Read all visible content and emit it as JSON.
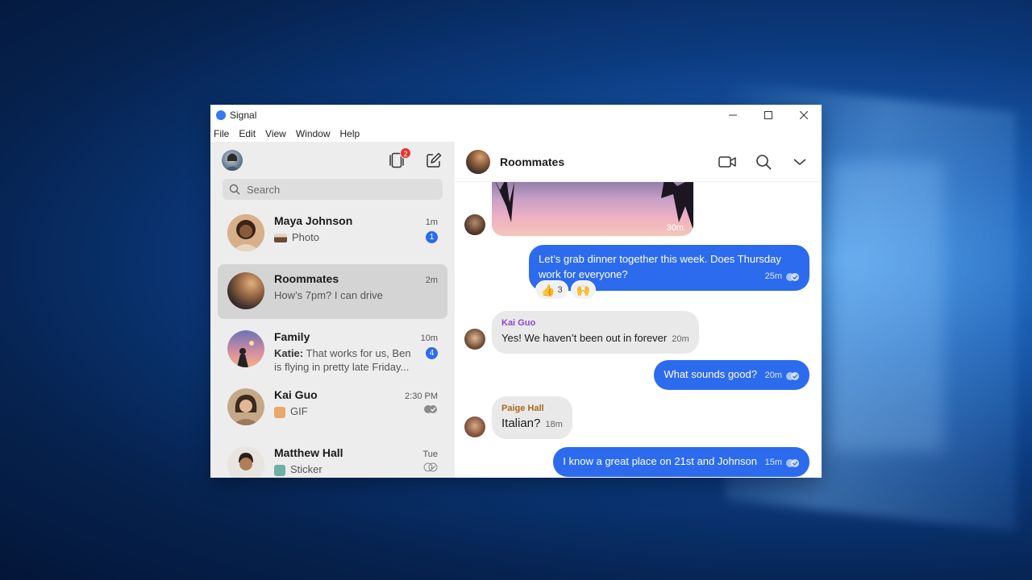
{
  "window": {
    "title": "Signal",
    "menu": [
      "File",
      "Edit",
      "View",
      "Window",
      "Help"
    ]
  },
  "sidebar": {
    "stories_badge": "2",
    "search_placeholder": "Search",
    "conversations": [
      {
        "name": "Maya Johnson",
        "time": "1m",
        "preview": "Photo",
        "unread": "1"
      },
      {
        "name": "Roommates",
        "time": "2m",
        "preview": "How’s 7pm? I can drive",
        "selected": true
      },
      {
        "name": "Family",
        "time": "10m",
        "preview_sender": "Katie:",
        "preview": "That works for us, Ben is flying in pretty late Friday...",
        "unread": "4"
      },
      {
        "name": "Kai Guo",
        "time": "2:30 PM",
        "preview": "GIF"
      },
      {
        "name": "Matthew Hall",
        "time": "Tue",
        "preview": "Sticker"
      }
    ]
  },
  "chat": {
    "title": "Roommates",
    "image_time": "30m",
    "messages": [
      {
        "dir": "out",
        "text": "Let’s grab dinner together this week. Does Thursday work for everyone?",
        "time": "25m",
        "reactions": [
          {
            "emoji": "👍",
            "count": "3"
          },
          {
            "emoji": "🙌"
          }
        ]
      },
      {
        "dir": "in",
        "sender": "Kai Guo",
        "sender_color": "#8c45d6",
        "text": "Yes! We haven’t been out in forever",
        "time": "20m"
      },
      {
        "dir": "out",
        "text": "What sounds good?",
        "time": "20m"
      },
      {
        "dir": "in",
        "sender": "Paige Hall",
        "sender_color": "#a9691c",
        "text": "Italian?",
        "time": "18m"
      },
      {
        "dir": "out",
        "text": "I know a great place on 21st and Johnson",
        "time": "15m"
      }
    ]
  },
  "colors": {
    "accent": "#2c6bed",
    "badge": "#e8312e"
  }
}
